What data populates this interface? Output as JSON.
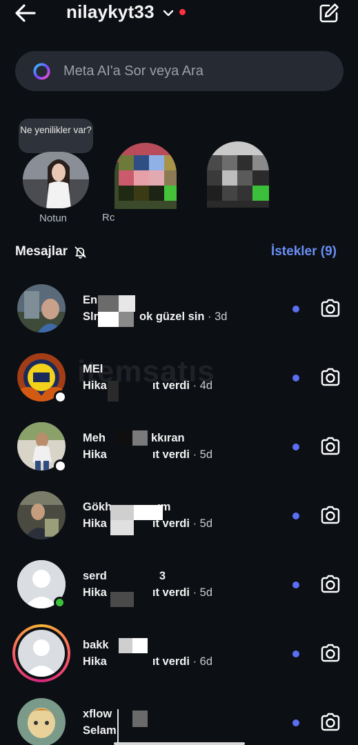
{
  "header": {
    "username": "nilaykyt33",
    "back_icon": "arrow-left-icon",
    "compose_icon": "compose-icon",
    "accent_dot_color": "#ff3040"
  },
  "search": {
    "placeholder": "Meta AI'a Sor veya Ara"
  },
  "notes": {
    "bubble_text": "Ne yenilikler var?",
    "items": [
      {
        "label": "Notun"
      },
      {
        "label": "Rc"
      },
      {
        "label": ""
      }
    ]
  },
  "messages_section": {
    "title": "Mesajlar",
    "muted_icon": "bell-off-icon",
    "requests_label": "İstekler (9)",
    "requests_color": "#6a8ff6"
  },
  "messages": [
    {
      "name": "En",
      "preview": "Slr",
      "preview_tail": "ok güzel sin",
      "time": "· 3d"
    },
    {
      "name": "MEl",
      "preview": "Hika",
      "preview_tail": "ıt verdi",
      "time": "· 4d"
    },
    {
      "name": "Meh",
      "name_tail": "kkıran",
      "preview": "Hika",
      "preview_tail": "ıt verdi",
      "time": "· 5d"
    },
    {
      "name": "Gökh",
      "name_tail": "ım",
      "preview": "Hika",
      "preview_tail": "ıt verdi",
      "time": "· 5d"
    },
    {
      "name": "serd",
      "name_tail": "3",
      "preview": "Hika",
      "preview_tail": "ıt verdi",
      "time": "· 5d"
    },
    {
      "name": "bakk",
      "preview": "Hika",
      "preview_tail": "ıt verdi",
      "time": "· 6d"
    },
    {
      "name": "xflow",
      "preview": "Selam",
      "preview_tail": "",
      "time": ""
    }
  ],
  "watermark": "itemsatış",
  "unread_color": "#5a6ff2"
}
